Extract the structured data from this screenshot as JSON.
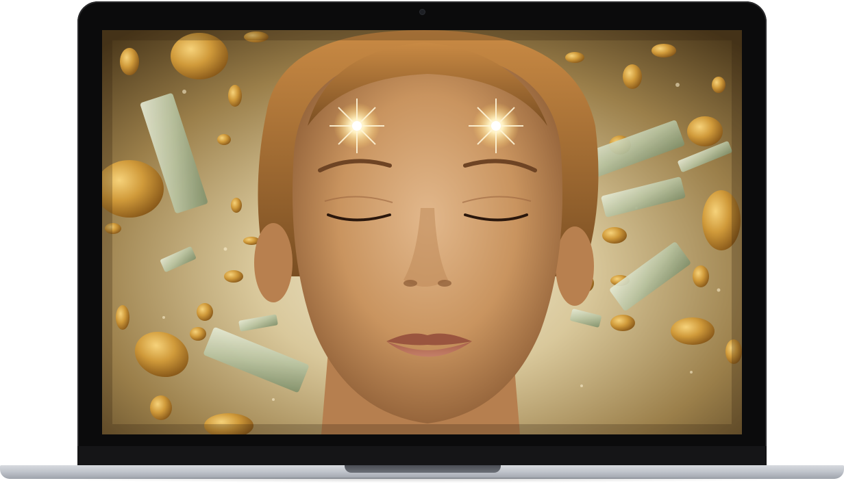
{
  "scene": {
    "icon_names": [
      "laptop-icon"
    ],
    "colors": {
      "bezel": "#0b0b0c",
      "base": "#c1c5cc",
      "gold": "#c8902c",
      "skin": "#c99569"
    }
  }
}
